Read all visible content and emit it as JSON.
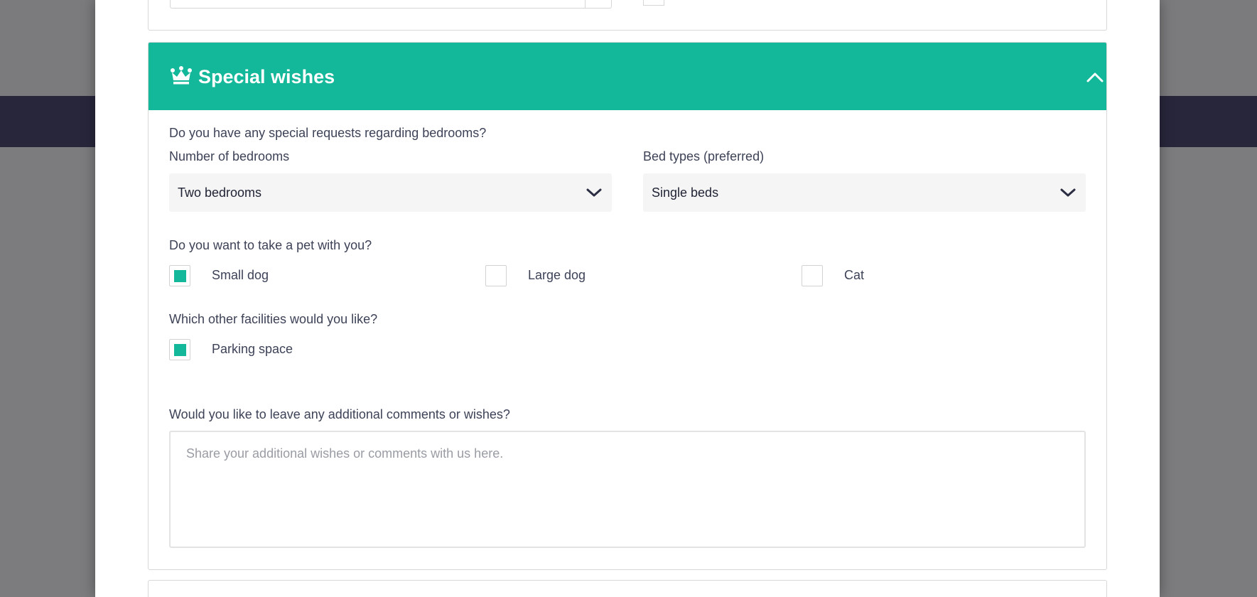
{
  "section": {
    "title": "Special wishes",
    "icon": "crown-icon",
    "collapse_icon": "chevron-up-icon",
    "accent_color": "#13b799"
  },
  "bedrooms": {
    "question": "Do you have any special requests regarding bedrooms?",
    "count_label": "Number of bedrooms",
    "count_value": "Two bedrooms",
    "bed_type_label": "Bed types (preferred)",
    "bed_type_value": "Single beds"
  },
  "pets": {
    "question": "Do you want to take a pet with you?",
    "options": [
      {
        "label": "Small dog",
        "checked": true
      },
      {
        "label": "Large dog",
        "checked": false
      },
      {
        "label": "Cat",
        "checked": false
      }
    ]
  },
  "facilities": {
    "question": "Which other facilities would you like?",
    "options": [
      {
        "label": "Parking space",
        "checked": true
      }
    ]
  },
  "comments": {
    "question": "Would you like to leave any additional comments or wishes?",
    "placeholder": "Share your additional wishes or comments with us here.",
    "value": ""
  }
}
